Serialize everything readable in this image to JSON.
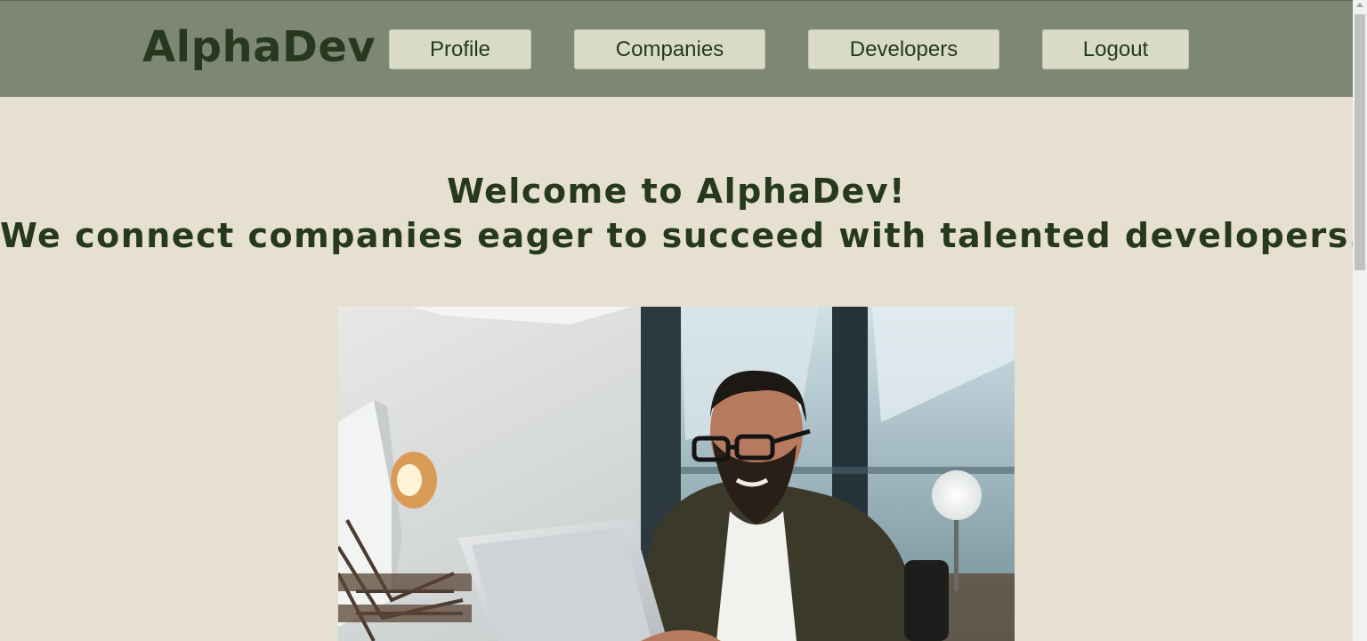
{
  "brand": {
    "name": "AlphaDev"
  },
  "nav": {
    "profile": "Profile",
    "companies": "Companies",
    "developers": "Developers",
    "logout": "Logout"
  },
  "hero": {
    "line1": "Welcome to AlphaDev!",
    "line2": "We connect companies eager to succeed with talented developers."
  },
  "colors": {
    "navbar": "#7e8774",
    "background": "#e6e0d0",
    "text": "#26391f",
    "button": "#d9dbc7"
  }
}
